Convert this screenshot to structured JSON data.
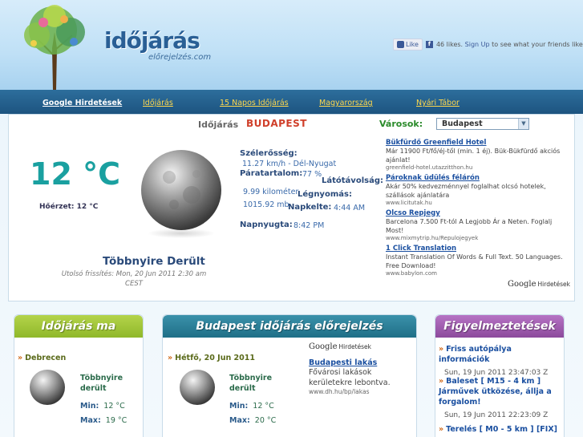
{
  "header": {
    "title": "időjárás",
    "subtitle": "előrejelzés.com",
    "fb_like_label": "Like",
    "fb_likes": "46 likes.",
    "fb_signup": "Sign Up",
    "fb_suffix": "to see what your friends like."
  },
  "nav": {
    "items": [
      "Google Hirdetések",
      "Időjárás",
      "15 Napos Időjárás",
      "Magyarország",
      "Nyári Tábor"
    ]
  },
  "current": {
    "label": "Időjárás",
    "city": "BUDAPEST",
    "cities_label": "Városok:",
    "selected_city": "Budapest",
    "temperature": "12 °C",
    "feels_like": "Hőérzet: 12 °C",
    "condition": "Többnyire Derült",
    "updated": "Utolsó frissítés: Mon, 20 Jun 2011 2:30 am CEST",
    "wind_label": "Szélerősség:",
    "wind_value": "11.27 km/h - Dél-Nyugat",
    "humidity_label": "Páratartalom:",
    "humidity_value": "77 %",
    "visibility_label": "Látótávolság:",
    "visibility_value": "9.99 kilométer",
    "pressure_label": "Légnyomás:",
    "pressure_value": "1015.92 mb",
    "sunrise_label": "Napkelte:",
    "sunrise_value": "4:44 AM",
    "sunset_label": "Napnyugta:",
    "sunset_value": "8:42 PM"
  },
  "ads_right": [
    {
      "title": "Bükfürdő Greenfield Hotel",
      "desc": "Már 11900 Ft/fő/éj-től (min. 1 éj). Bük-Bükfürdő akciós ajánlat!",
      "url": "greenfield-hotel.utazzitthon.hu"
    },
    {
      "title": "Pároknak üdülés félárón",
      "desc": "Akár 50% kedvezménnyel foglalhat olcsó hotelek, szállások ajánlatára",
      "url": "www.licitutak.hu"
    },
    {
      "title": "Olcso Repjegy",
      "desc": "Barcelona 7.500 Ft-tól A Legjobb Ár a Neten. Foglalj Most!",
      "url": "www.mixmytrip.hu/Repulojegyek"
    },
    {
      "title": "1 Click Translation",
      "desc": "Instant Translation Of Words & Full Text. 50 Languages. Free Download!",
      "url": "www.babylon.com"
    }
  ],
  "google_mark": {
    "brand": "Google",
    "label": "Hirdetések"
  },
  "box_today": {
    "title": "Időjárás ma",
    "city": "Debrecen",
    "condition": "Többnyire derült",
    "min_label": "Min:",
    "min_value": "12 °C",
    "max_label": "Max:",
    "max_value": "19 °C"
  },
  "box_forecast": {
    "title": "Budapest időjárás előrejelzés",
    "day": "Hétfő, 20 Jun 2011",
    "condition": "Többnyire derült",
    "min_label": "Min:",
    "min_value": "12 °C",
    "max_label": "Max:",
    "max_value": "20 °C",
    "ad": {
      "title": "Budapesti lakás",
      "desc": "Fővárosi lakások kerületekre lebontva.",
      "url": "www.dh.hu/bp/lakas"
    }
  },
  "box_warnings": {
    "title": "Figyelmeztetések",
    "items": [
      {
        "title": "Friss autópálya információk",
        "date": "Sun, 19 Jun 2011 23:47:03 Z"
      },
      {
        "title": "Baleset [ M15 - 4 km ] Járművek ütközése, állja a forgalom!",
        "date": "Sun, 19 Jun 2011 22:23:09 Z"
      },
      {
        "title": "Terelés [ M0 - 5 km ] [FIX]",
        "date": ""
      }
    ]
  },
  "colors": {
    "nav_bg": "#1d5480",
    "nav_link": "#ffd84d",
    "temp": "#1aa0a0",
    "city": "#d0402b",
    "green_head": "#8fb82a",
    "teal_head": "#1f6f87",
    "purple_head": "#8c4a9c"
  }
}
